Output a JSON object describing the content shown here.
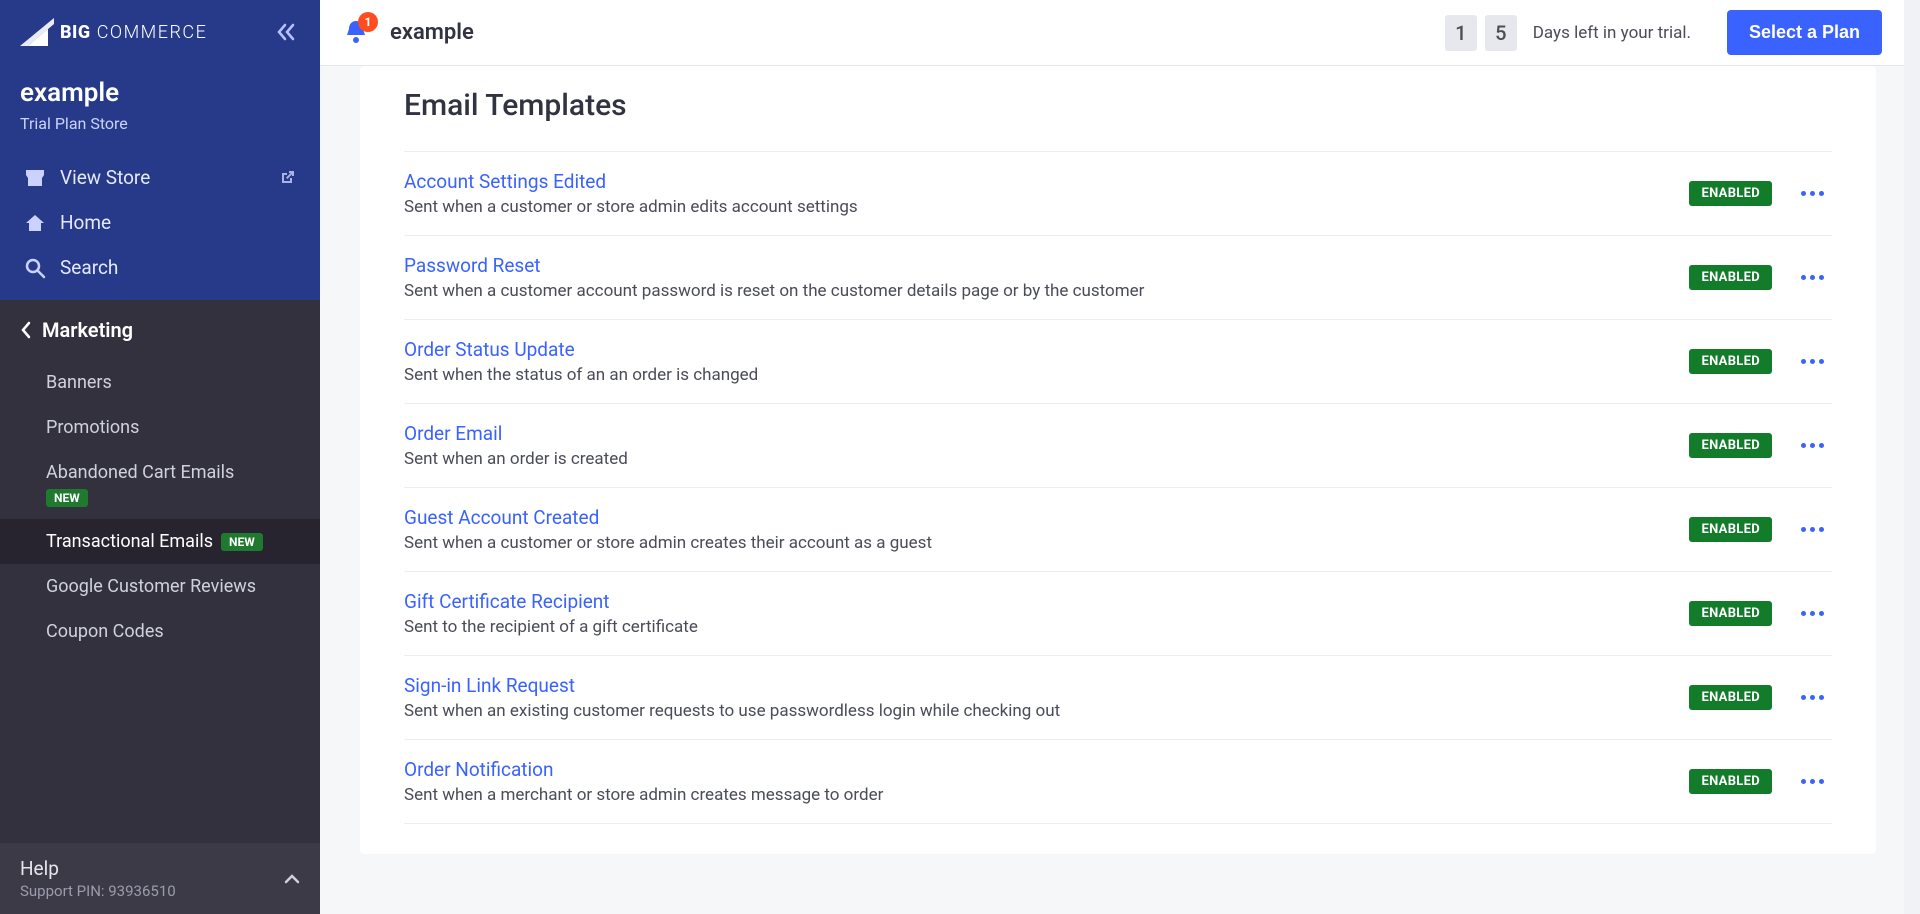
{
  "brand": {
    "bold": "BIG",
    "light": "COMMERCE"
  },
  "store": {
    "name": "example",
    "plan": "Trial Plan Store"
  },
  "quicknav": {
    "view_store": "View Store",
    "home": "Home",
    "search": "Search"
  },
  "section": {
    "back_label": "Marketing",
    "items": [
      {
        "label": "Banners",
        "new": false
      },
      {
        "label": "Promotions",
        "new": false
      },
      {
        "label": "Abandoned Cart Emails",
        "new": true,
        "block_badge": true
      },
      {
        "label": "Transactional Emails",
        "new": true,
        "active": true
      },
      {
        "label": "Google Customer Reviews",
        "new": false
      },
      {
        "label": "Coupon Codes",
        "new": false
      }
    ],
    "new_badge": "NEW"
  },
  "footer": {
    "help": "Help",
    "pin_label": "Support PIN: ",
    "pin_value": "93936510"
  },
  "topbar": {
    "notif_count": "1",
    "breadcrumb": "example",
    "trial_digits": [
      "1",
      "5"
    ],
    "trial_text": "Days left in your trial.",
    "select_plan": "Select a Plan"
  },
  "page": {
    "heading": "Email Templates",
    "enabled_label": "ENABLED",
    "templates": [
      {
        "title": "Account Settings Edited",
        "desc": "Sent when a customer or store admin edits account settings"
      },
      {
        "title": "Password Reset",
        "desc": "Sent when a customer account password is reset on the customer details page or by the customer"
      },
      {
        "title": "Order Status Update",
        "desc": "Sent when the status of an an order is changed"
      },
      {
        "title": "Order Email",
        "desc": "Sent when an order is created"
      },
      {
        "title": "Guest Account Created",
        "desc": "Sent when a customer or store admin creates their account as a guest"
      },
      {
        "title": "Gift Certificate Recipient",
        "desc": "Sent to the recipient of a gift certificate"
      },
      {
        "title": "Sign-in Link Request",
        "desc": "Sent when an existing customer requests to use passwordless login while checking out"
      },
      {
        "title": "Order Notification",
        "desc": "Sent when a merchant or store admin creates message to order"
      }
    ]
  }
}
